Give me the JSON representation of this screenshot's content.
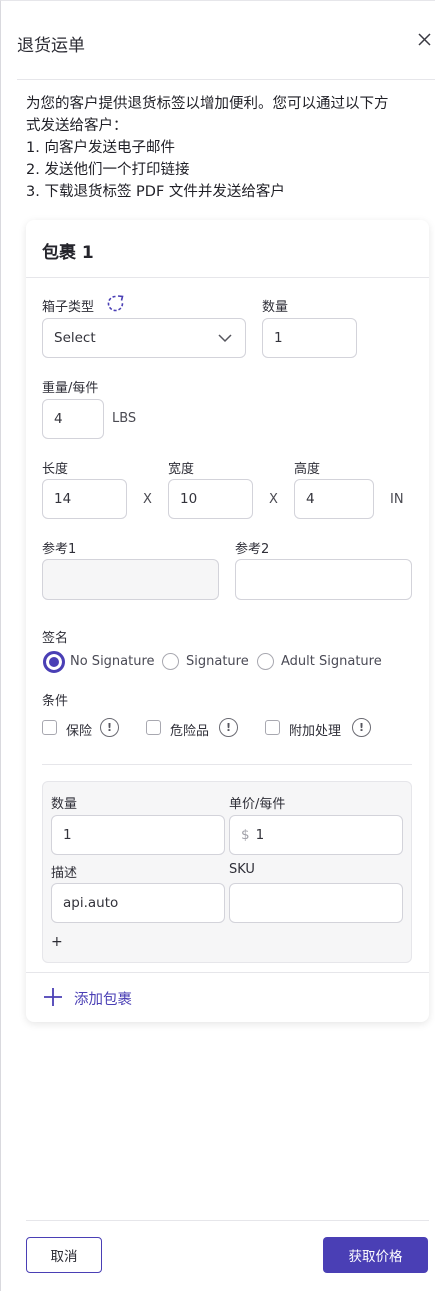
{
  "dialog": {
    "title": "退货运单"
  },
  "intro": {
    "lines": [
      "为您的客户提供退货标签以增加便利。您可以通过以下方",
      "式发送给客户：",
      "1. 向客户发送电子邮件",
      "2. 发送他们一个打印链接",
      "3. 下载退货标签 PDF 文件并发送给客户"
    ]
  },
  "package": {
    "title": "包裹 1",
    "box_type": {
      "label": "箱子类型",
      "value": "Select"
    },
    "quantity": {
      "label": "数量",
      "value": "1"
    },
    "weight": {
      "label": "重量/每件",
      "value": "4",
      "unit": "LBS"
    },
    "length": {
      "label": "长度",
      "value": "14"
    },
    "width": {
      "label": "宽度",
      "value": "10"
    },
    "height": {
      "label": "高度",
      "value": "4"
    },
    "separator": "X",
    "dim_unit": "IN",
    "reference1": {
      "label": "参考1",
      "value": ""
    },
    "reference2": {
      "label": "参考2",
      "value": ""
    },
    "signature": {
      "label": "签名",
      "options": [
        "No Signature",
        "Signature",
        "Adult Signature"
      ],
      "selected": "No Signature"
    },
    "conditions": {
      "label": "条件",
      "options": [
        "保险",
        "危险品",
        "附加处理"
      ],
      "info_glyph": "!"
    },
    "item": {
      "quantity_label": "数量",
      "quantity_value": "1",
      "unit_price_label": "单价/每件",
      "currency_symbol": "$",
      "unit_price_value": "1",
      "description_label": "描述",
      "description_value": "api.auto",
      "sku_label": "SKU",
      "sku_value": "",
      "add_item": "+"
    },
    "add_package": "添加包裹"
  },
  "footer": {
    "cancel": "取消",
    "submit": "获取价格"
  },
  "colors": {
    "accent": "#4a3fb5",
    "border": "#d3d3da",
    "disabled_bg": "#f6f6f7"
  },
  "icons": [
    "close-icon",
    "refresh-icon",
    "chevron-down-icon",
    "info-icon",
    "plus-icon"
  ]
}
